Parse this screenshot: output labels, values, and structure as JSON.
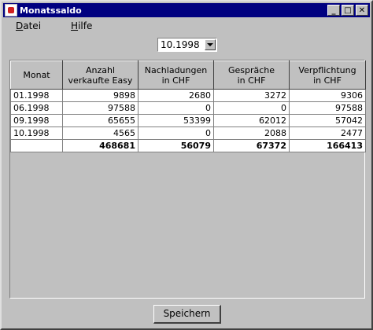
{
  "window": {
    "title": "Monatssaldo"
  },
  "menu": {
    "file_prefix": "D",
    "file_rest": "atei",
    "help_prefix": "H",
    "help_rest": "ilfe"
  },
  "month_select": {
    "value": "10.1998"
  },
  "table": {
    "headers": [
      {
        "line1": "Monat",
        "line2": ""
      },
      {
        "line1": "Anzahl",
        "line2": "verkaufte Easy"
      },
      {
        "line1": "Nachladungen",
        "line2": "in CHF"
      },
      {
        "line1": "Gespräche",
        "line2": "in CHF"
      },
      {
        "line1": "Verpflichtung",
        "line2": "in CHF"
      }
    ],
    "rows": [
      [
        "01.1998",
        "9898",
        "2680",
        "3272",
        "9306"
      ],
      [
        "06.1998",
        "97588",
        "0",
        "0",
        "97588"
      ],
      [
        "09.1998",
        "65655",
        "53399",
        "62012",
        "57042"
      ],
      [
        "10.1998",
        "4565",
        "0",
        "2088",
        "2477"
      ]
    ],
    "totals": [
      "",
      "468681",
      "56079",
      "67372",
      "166413"
    ]
  },
  "save_button": {
    "label": "Speichern"
  }
}
